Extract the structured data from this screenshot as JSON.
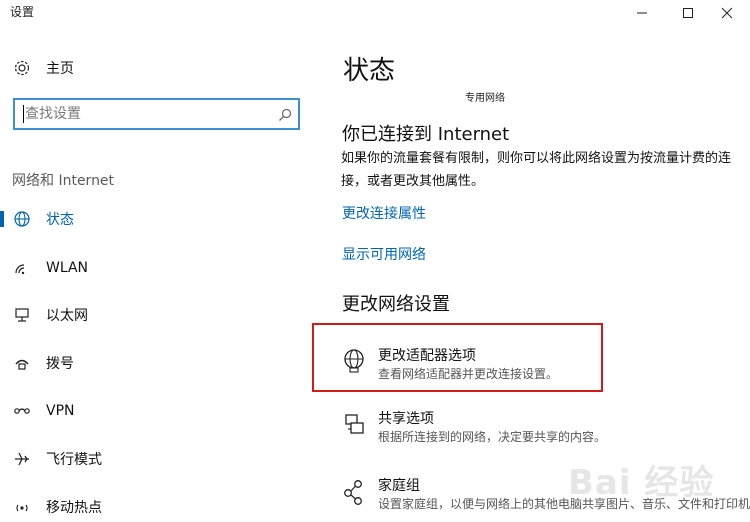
{
  "window": {
    "title": "设置"
  },
  "sidebar": {
    "home_label": "主页",
    "search_placeholder": "查找设置",
    "section_label": "网络和 Internet",
    "items": [
      {
        "label": "状态",
        "icon": "globe-icon",
        "active": true
      },
      {
        "label": "WLAN",
        "icon": "wifi-icon"
      },
      {
        "label": "以太网",
        "icon": "ethernet-icon"
      },
      {
        "label": "拨号",
        "icon": "dialup-icon"
      },
      {
        "label": "VPN",
        "icon": "vpn-icon"
      },
      {
        "label": "飞行模式",
        "icon": "airplane-icon"
      },
      {
        "label": "移动热点",
        "icon": "hotspot-icon"
      }
    ]
  },
  "main": {
    "title": "状态",
    "network_name": "专用网络",
    "connected_heading": "你已连接到 Internet",
    "connected_desc": "如果你的流量套餐有限制，则你可以将此网络设置为按流量计费的连接，或者更改其他属性。",
    "links": {
      "change_properties": "更改连接属性",
      "show_networks": "显示可用网络"
    },
    "change_heading": "更改网络设置",
    "options": [
      {
        "title": "更改适配器选项",
        "desc": "查看网络适配器并更改连接设置。",
        "icon": "adapter-globe-icon"
      },
      {
        "title": "共享选项",
        "desc": "根据所连接到的网络，决定要共享的内容。",
        "icon": "sharing-icon"
      },
      {
        "title": "家庭组",
        "desc": "设置家庭组，以便与网络上的其他电脑共享图片、音乐、文件和打印机。",
        "icon": "homegroup-icon"
      }
    ]
  },
  "watermark": "Bai 经验",
  "colors": {
    "accent": "#0063b1",
    "highlight": "#d11a1a"
  }
}
